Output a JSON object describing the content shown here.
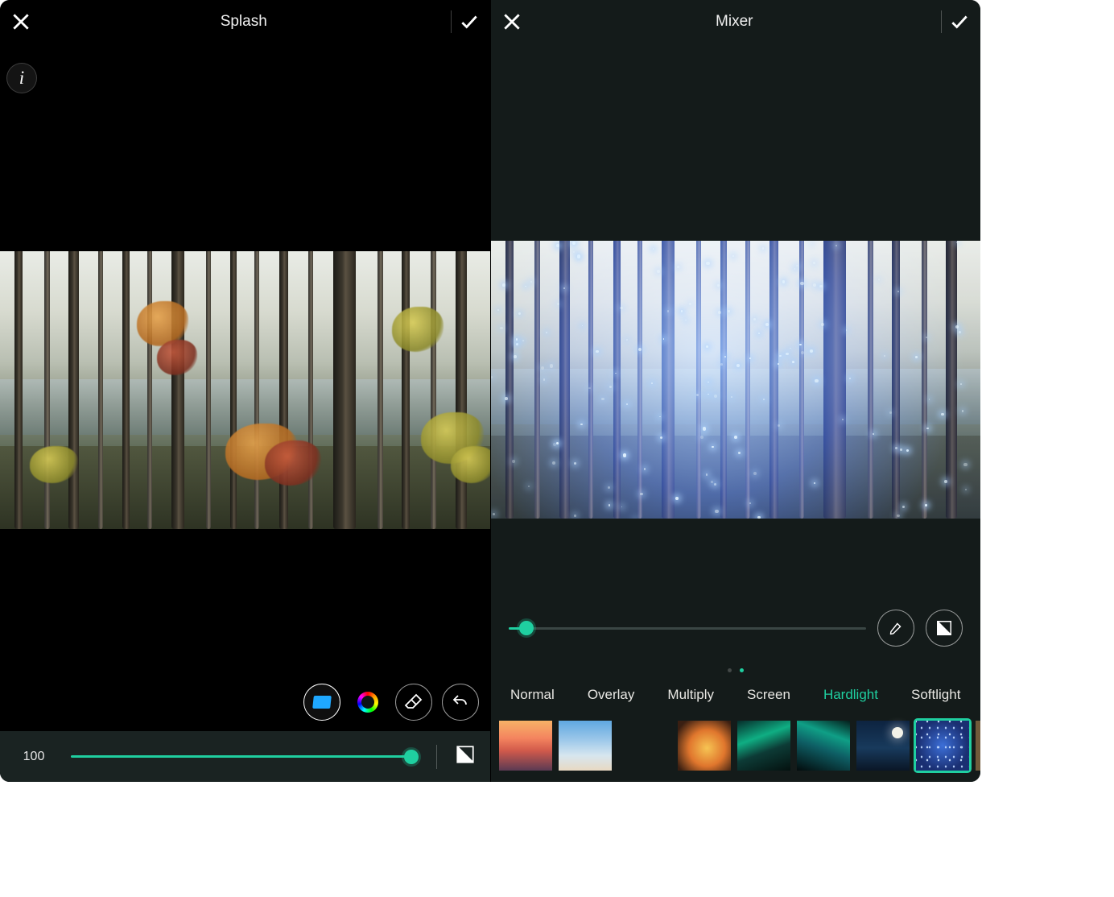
{
  "left": {
    "title": "Splash",
    "slider": {
      "value": 100,
      "fill_pct": 98
    },
    "tools": {
      "rect": "shape-button",
      "color": "color-picker-button",
      "eraser": "eraser-button",
      "undo": "undo-button"
    }
  },
  "right": {
    "title": "Mixer",
    "slider": {
      "fill_pct": 5
    },
    "dots": {
      "count": 2,
      "active": 1
    },
    "blend_modes": [
      "Normal",
      "Overlay",
      "Multiply",
      "Screen",
      "Hardlight",
      "Softlight"
    ],
    "blend_active": 4,
    "textures": [
      {
        "name": "sunset"
      },
      {
        "name": "sky2"
      },
      {
        "name": "storm"
      },
      {
        "name": "fire"
      },
      {
        "name": "aurora1"
      },
      {
        "name": "aurora2"
      },
      {
        "name": "moon"
      },
      {
        "name": "bluebits",
        "selected": true
      },
      {
        "name": "bokeh"
      }
    ]
  },
  "accent": "#1fcfa0"
}
